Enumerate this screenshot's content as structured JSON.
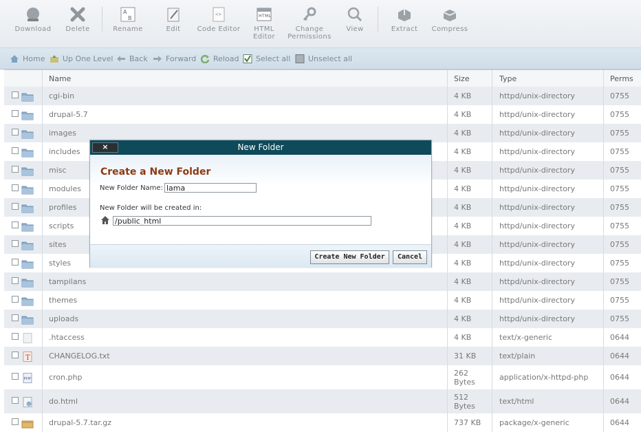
{
  "toolbar": {
    "download": "Download",
    "delete": "Delete",
    "rename": "Rename",
    "edit": "Edit",
    "code_editor": "Code Editor",
    "html_editor_1": "HTML",
    "html_editor_2": "Editor",
    "change_permissions_1": "Change",
    "change_permissions_2": "Permissions",
    "view": "View",
    "extract": "Extract",
    "compress": "Compress"
  },
  "navbar": {
    "home": "Home",
    "up_one_level": "Up One Level",
    "back": "Back",
    "forward": "Forward",
    "reload": "Reload",
    "select_all": "Select all",
    "unselect_all": "Unselect all"
  },
  "table": {
    "headers": {
      "name": "Name",
      "size": "Size",
      "type": "Type",
      "perms": "Perms"
    },
    "rows": [
      {
        "name": "cgi-bin",
        "size": "4 KB",
        "type": "httpd/unix-directory",
        "perms": "0755",
        "icon": "folder"
      },
      {
        "name": "drupal-5.7",
        "size": "4 KB",
        "type": "httpd/unix-directory",
        "perms": "0755",
        "icon": "folder"
      },
      {
        "name": "images",
        "size": "4 KB",
        "type": "httpd/unix-directory",
        "perms": "0755",
        "icon": "folder"
      },
      {
        "name": "includes",
        "size": "4 KB",
        "type": "httpd/unix-directory",
        "perms": "0755",
        "icon": "folder"
      },
      {
        "name": "misc",
        "size": "4 KB",
        "type": "httpd/unix-directory",
        "perms": "0755",
        "icon": "folder"
      },
      {
        "name": "modules",
        "size": "4 KB",
        "type": "httpd/unix-directory",
        "perms": "0755",
        "icon": "folder"
      },
      {
        "name": "profiles",
        "size": "4 KB",
        "type": "httpd/unix-directory",
        "perms": "0755",
        "icon": "folder"
      },
      {
        "name": "scripts",
        "size": "4 KB",
        "type": "httpd/unix-directory",
        "perms": "0755",
        "icon": "folder"
      },
      {
        "name": "sites",
        "size": "4 KB",
        "type": "httpd/unix-directory",
        "perms": "0755",
        "icon": "folder"
      },
      {
        "name": "styles",
        "size": "4 KB",
        "type": "httpd/unix-directory",
        "perms": "0755",
        "icon": "folder"
      },
      {
        "name": "tampilans",
        "size": "4 KB",
        "type": "httpd/unix-directory",
        "perms": "0755",
        "icon": "folder"
      },
      {
        "name": "themes",
        "size": "4 KB",
        "type": "httpd/unix-directory",
        "perms": "0755",
        "icon": "folder"
      },
      {
        "name": "uploads",
        "size": "4 KB",
        "type": "httpd/unix-directory",
        "perms": "0755",
        "icon": "folder"
      },
      {
        "name": ".htaccess",
        "size": "4 KB",
        "type": "text/x-generic",
        "perms": "0644",
        "icon": "generic-file"
      },
      {
        "name": "CHANGELOG.txt",
        "size": "31 KB",
        "type": "text/plain",
        "perms": "0644",
        "icon": "text-file"
      },
      {
        "name": "cron.php",
        "size_1": "262",
        "size_2": "Bytes",
        "type": "application/x-httpd-php",
        "perms": "0644",
        "icon": "php-file"
      },
      {
        "name": "do.html",
        "size_1": "512",
        "size_2": "Bytes",
        "type": "text/html",
        "perms": "0644",
        "icon": "html-file"
      },
      {
        "name": "drupal-5.7.tar.gz",
        "size": "737 KB",
        "type": "package/x-generic",
        "perms": "0644",
        "icon": "archive-file"
      }
    ]
  },
  "modal": {
    "title": "New Folder",
    "close": "×",
    "heading": "Create a New Folder",
    "name_label": "New Folder Name:",
    "name_value": "lama",
    "location_label": "New Folder will be created in:",
    "location_value": "/public_html",
    "create_button": "Create New Folder",
    "cancel_button": "Cancel"
  },
  "colors": {
    "modal_title_bar": "#0f4a5a",
    "heading": "#8c3a12",
    "row_alt": "#e8ecf1"
  }
}
